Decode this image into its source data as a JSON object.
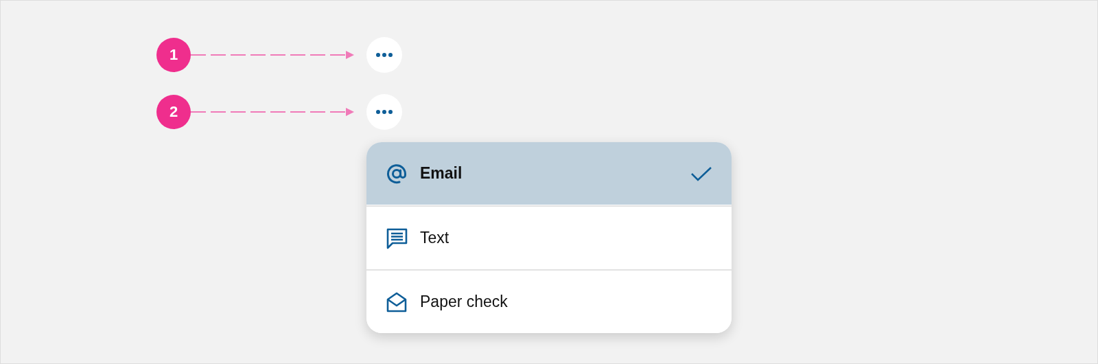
{
  "markers": [
    {
      "number": "1"
    },
    {
      "number": "2"
    }
  ],
  "menu": {
    "items": [
      {
        "label": "Email",
        "selected": true
      },
      {
        "label": "Text",
        "selected": false
      },
      {
        "label": "Paper check",
        "selected": false
      }
    ]
  }
}
